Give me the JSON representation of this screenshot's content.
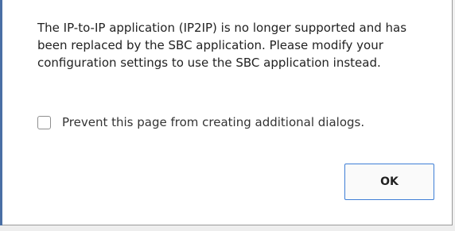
{
  "dialog": {
    "message": "The IP-to-IP application (IP2IP) is no longer supported and has been replaced by the SBC application. Please modify your configuration settings to use the SBC application instead.",
    "prevent_dialogs_label": "Prevent this page from creating additional dialogs.",
    "prevent_dialogs_checked": false,
    "ok_label": "OK"
  },
  "colors": {
    "ok_border": "#3f7fd6",
    "dialog_border": "#9a9a9a",
    "text": "#222222"
  }
}
